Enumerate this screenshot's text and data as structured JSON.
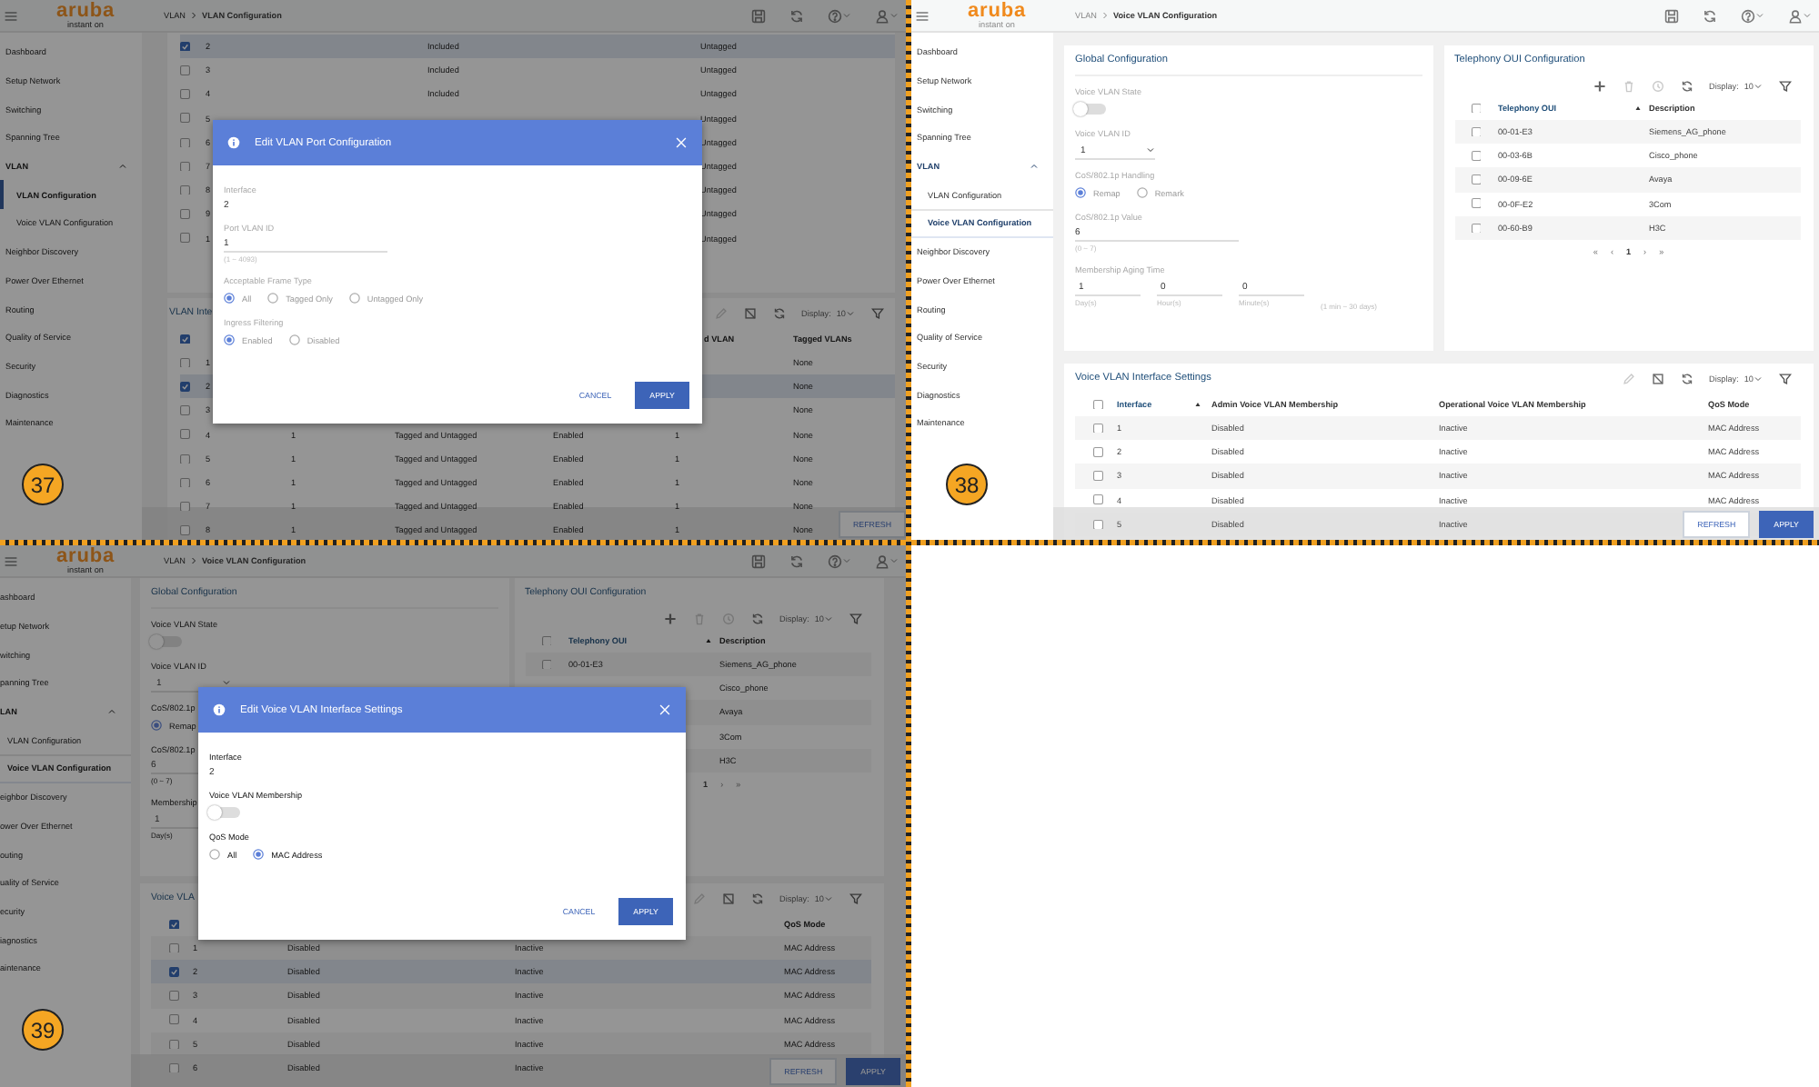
{
  "panels": [
    {
      "kind": "vlan_port",
      "badge": "37",
      "dimmed": true,
      "header": {
        "logo": "aruba",
        "logo_sub": "instant on",
        "breadcrumb": [
          "VLAN",
          "VLAN Configuration"
        ]
      },
      "sidebar": [
        {
          "label": "Dashboard",
          "selected": false
        },
        {
          "label": "Setup Network",
          "selected": false
        },
        {
          "label": "Switching",
          "selected": false
        },
        {
          "label": "Spanning Tree",
          "selected": false
        },
        {
          "label": "VLAN",
          "selected": false,
          "expanded": true,
          "children": [
            {
              "label": "VLAN Configuration",
              "selected": true
            },
            {
              "label": "Voice VLAN Configuration",
              "selected": false
            }
          ]
        },
        {
          "label": "Neighbor Discovery",
          "selected": false
        },
        {
          "label": "Power Over Ethernet",
          "selected": false
        },
        {
          "label": "Routing",
          "selected": false
        },
        {
          "label": "Quality of Service",
          "selected": false
        },
        {
          "label": "Security",
          "selected": false
        },
        {
          "label": "Diagnostics",
          "selected": false
        },
        {
          "label": "Maintenance",
          "selected": false
        }
      ],
      "membership_table": {
        "rows": [
          {
            "interface": "2",
            "checked": true,
            "membership": "Included",
            "tagging": "Untagged"
          },
          {
            "interface": "3",
            "checked": false,
            "membership": "Included",
            "tagging": "Untagged"
          },
          {
            "interface": "4",
            "checked": false,
            "membership": "Included",
            "tagging": "Untagged"
          },
          {
            "interface": "5",
            "checked": false,
            "tagging": "Untagged"
          },
          {
            "interface": "6",
            "checked": false,
            "tagging": "Untagged"
          },
          {
            "interface": "7",
            "checked": false,
            "tagging": "Untagged"
          },
          {
            "interface": "8",
            "checked": false,
            "tagging": "Untagged"
          },
          {
            "interface": "9",
            "checked": false,
            "tagging": "Untagged"
          },
          {
            "interface": "1",
            "checked": false,
            "tagging": "Untagged"
          }
        ]
      },
      "interface_table": {
        "title": "VLAN Inte",
        "toolbar": {
          "tools": [
            {
              "kind": "edit",
              "disabled": true
            },
            {
              "kind": "clear",
              "disabled": false
            },
            {
              "kind": "refresh",
              "disabled": false
            }
          ],
          "display_label": "Display:",
          "display_value": "10"
        },
        "header": {
          "checked": true,
          "untagged": "d VLAN",
          "tagged": "Tagged VLANs"
        },
        "rows": [
          {
            "interface": "1",
            "checked": false,
            "tagged": "None"
          },
          {
            "interface": "2",
            "checked": true,
            "tagged": "None"
          },
          {
            "interface": "3",
            "checked": false,
            "tagged": "None"
          },
          {
            "interface": "4",
            "checked": false,
            "pvid": "1",
            "frame": "Tagged and Untagged",
            "ingress": "Enabled",
            "untagged": "1",
            "tagged": "None"
          },
          {
            "interface": "5",
            "checked": false,
            "pvid": "1",
            "frame": "Tagged and Untagged",
            "ingress": "Enabled",
            "untagged": "1",
            "tagged": "None"
          },
          {
            "interface": "6",
            "checked": false,
            "pvid": "1",
            "frame": "Tagged and Untagged",
            "ingress": "Enabled",
            "untagged": "1",
            "tagged": "None"
          },
          {
            "interface": "7",
            "checked": false,
            "pvid": "1",
            "frame": "Tagged and Untagged",
            "ingress": "Enabled",
            "untagged": "1",
            "tagged": "None"
          },
          {
            "interface": "8",
            "checked": false,
            "pvid": "1",
            "frame": "Tagged and Untagged",
            "ingress": "Enabled",
            "untagged": "1",
            "tagged": "None"
          }
        ]
      },
      "footer": {
        "buttons": [
          {
            "label": "REFRESH",
            "kind": "outline"
          }
        ]
      },
      "modal": {
        "title": "Edit VLAN Port Configuration",
        "fields": [
          {
            "kind": "static",
            "label": "Interface",
            "value": "2"
          },
          {
            "kind": "input",
            "label": "Port VLAN ID",
            "value": "1",
            "hint": "(1 ~ 4093)"
          },
          {
            "kind": "radio",
            "label": "Acceptable Frame Type",
            "options": [
              {
                "label": "All",
                "selected": true
              },
              {
                "label": "Tagged Only",
                "selected": false
              },
              {
                "label": "Untagged Only",
                "selected": false
              }
            ]
          },
          {
            "kind": "radio",
            "label": "Ingress Filtering",
            "options": [
              {
                "label": "Enabled",
                "selected": true
              },
              {
                "label": "Disabled",
                "selected": false
              }
            ]
          }
        ],
        "buttons": [
          {
            "label": "CANCEL",
            "kind": "text"
          },
          {
            "label": "APPLY",
            "kind": "primary"
          }
        ]
      }
    },
    {
      "kind": "voice_vlan",
      "badge": "38",
      "dimmed": false,
      "header": {
        "logo": "aruba",
        "logo_sub": "instant on",
        "breadcrumb": [
          "VLAN",
          "Voice VLAN Configuration"
        ]
      },
      "sidebar": [
        {
          "label": "Dashboard",
          "selected": false
        },
        {
          "label": "Setup Network",
          "selected": false
        },
        {
          "label": "Switching",
          "selected": false
        },
        {
          "label": "Spanning Tree",
          "selected": false
        },
        {
          "label": "VLAN",
          "selected": false,
          "expanded": true,
          "children": [
            {
              "label": "VLAN Configuration",
              "selected": false
            },
            {
              "label": "Voice VLAN Configuration",
              "selected": true
            }
          ]
        },
        {
          "label": "Neighbor Discovery",
          "selected": false
        },
        {
          "label": "Power Over Ethernet",
          "selected": false
        },
        {
          "label": "Routing",
          "selected": false
        },
        {
          "label": "Quality of Service",
          "selected": false
        },
        {
          "label": "Security",
          "selected": false
        },
        {
          "label": "Diagnostics",
          "selected": false
        },
        {
          "label": "Maintenance",
          "selected": false
        }
      ],
      "global": {
        "title": "Global Configuration",
        "state_label": "Voice VLAN State",
        "state_on": false,
        "id_label": "Voice VLAN ID",
        "id_value": "1",
        "handling_label": "CoS/802.1p Handling",
        "handling_options": [
          {
            "label": "Remap",
            "selected": true
          },
          {
            "label": "Remark",
            "selected": false
          }
        ],
        "value_label": "CoS/802.1p Value",
        "value": "6",
        "value_hint": "(0 ~ 7)",
        "aging_label": "Membership Aging Time",
        "aging": [
          {
            "value": "1",
            "unit": "Day(s)"
          },
          {
            "value": "0",
            "unit": "Hour(s)"
          },
          {
            "value": "0",
            "unit": "Minute(s)"
          }
        ],
        "aging_hint": "(1 min ~ 30 days)"
      },
      "telephony": {
        "title": "Telephony OUI Configuration",
        "toolbar": {
          "tools": [
            {
              "kind": "add",
              "disabled": false
            },
            {
              "kind": "delete",
              "disabled": true
            },
            {
              "kind": "history",
              "disabled": true
            },
            {
              "kind": "refresh",
              "disabled": false
            }
          ],
          "display_label": "Display:",
          "display_value": "10"
        },
        "header": {
          "checked": false,
          "oui": "Telephony OUI",
          "sorted": true,
          "description": "Description"
        },
        "rows": [
          {
            "checked": false,
            "oui": "00-01-E3",
            "description": "Siemens_AG_phone"
          },
          {
            "checked": false,
            "oui": "00-03-6B",
            "description": "Cisco_phone"
          },
          {
            "checked": false,
            "oui": "00-09-6E",
            "description": "Avaya"
          },
          {
            "checked": false,
            "oui": "00-0F-E2",
            "description": "3Com"
          },
          {
            "checked": false,
            "oui": "00-60-B9",
            "description": "H3C"
          }
        ],
        "pagination": [
          {
            "label": "«",
            "selected": false
          },
          {
            "label": "‹",
            "selected": false
          },
          {
            "label": "1",
            "selected": true
          },
          {
            "label": "›",
            "selected": false
          },
          {
            "label": "»",
            "selected": false
          }
        ]
      },
      "interfaces": {
        "title": "Voice VLAN Interface Settings",
        "toolbar": {
          "tools": [
            {
              "kind": "edit",
              "disabled": true
            },
            {
              "kind": "clear",
              "disabled": false
            },
            {
              "kind": "refresh",
              "disabled": false
            }
          ],
          "display_label": "Display:",
          "display_value": "10"
        },
        "header": {
          "checked": false,
          "interface": "Interface",
          "sorted": true,
          "admin": "Admin Voice VLAN Membership",
          "operational": "Operational Voice VLAN Membership",
          "qos": "QoS Mode"
        },
        "rows": [
          {
            "checked": false,
            "interface": "1",
            "admin": "Disabled",
            "operational": "Inactive",
            "qos": "MAC Address"
          },
          {
            "checked": false,
            "interface": "2",
            "admin": "Disabled",
            "operational": "Inactive",
            "qos": "MAC Address"
          },
          {
            "checked": false,
            "interface": "3",
            "admin": "Disabled",
            "operational": "Inactive",
            "qos": "MAC Address"
          },
          {
            "checked": false,
            "interface": "4",
            "admin": "Disabled",
            "operational": "Inactive",
            "qos": "MAC Address"
          },
          {
            "checked": false,
            "interface": "5",
            "admin": "Disabled",
            "operational": "Inactive"
          }
        ]
      },
      "footer": {
        "buttons": [
          {
            "label": "REFRESH",
            "kind": "outline"
          },
          {
            "label": "APPLY",
            "kind": "primary"
          }
        ]
      }
    },
    {
      "kind": "voice_vlan",
      "badge": "39",
      "dimmed": true,
      "header": {
        "logo": "aruba",
        "logo_sub": "instant on",
        "breadcrumb": [
          "VLAN",
          "Voice VLAN Configuration"
        ]
      },
      "sidebar": [
        {
          "label": "ashboard",
          "selected": false
        },
        {
          "label": "etup Network",
          "selected": false
        },
        {
          "label": "witching",
          "selected": false
        },
        {
          "label": "panning Tree",
          "selected": false
        },
        {
          "label": "LAN",
          "selected": false,
          "expanded": true,
          "children": [
            {
              "label": "VLAN Configuration",
              "selected": false
            },
            {
              "label": "Voice VLAN Configuration",
              "selected": true
            }
          ]
        },
        {
          "label": "eighbor Discovery",
          "selected": false
        },
        {
          "label": "ower Over Ethernet",
          "selected": false
        },
        {
          "label": "outing",
          "selected": false
        },
        {
          "label": "uality of Service",
          "selected": false
        },
        {
          "label": "ecurity",
          "selected": false
        },
        {
          "label": "iagnostics",
          "selected": false
        },
        {
          "label": "aintenance",
          "selected": false
        }
      ],
      "global": {
        "title": "Global Configuration",
        "state_label": "Voice VLAN State",
        "state_on": false,
        "id_label": "Voice VLAN ID",
        "id_value": "1",
        "handling_label": "CoS/802.1p",
        "handling_options": [
          {
            "label": "Remap",
            "selected": true
          }
        ],
        "value_label": "CoS/802.1p",
        "value": "6",
        "value_hint": "(0 ~ 7)",
        "aging_label": "Membership",
        "aging": [
          {
            "value": "1",
            "unit": "Day(s)"
          }
        ]
      },
      "telephony": {
        "title": "Telephony OUI Configuration",
        "toolbar": {
          "tools": [
            {
              "kind": "add",
              "disabled": false
            },
            {
              "kind": "delete",
              "disabled": true
            },
            {
              "kind": "history",
              "disabled": true
            },
            {
              "kind": "refresh",
              "disabled": false
            }
          ],
          "display_label": "Display:",
          "display_value": "10"
        },
        "header": {
          "checked": false,
          "oui": "Telephony OUI",
          "sorted": true,
          "description": "Description"
        },
        "rows": [
          {
            "checked": false,
            "oui": "00-01-E3",
            "description": "Siemens_AG_phone"
          },
          {
            "description": "Cisco_phone"
          },
          {
            "description": "Avaya"
          },
          {
            "description": "3Com"
          },
          {
            "description": "H3C"
          }
        ],
        "pagination": [
          {
            "label": "1",
            "selected": true
          },
          {
            "label": "›",
            "selected": false
          },
          {
            "label": "»",
            "selected": false
          }
        ]
      },
      "interfaces": {
        "title": "Voice VLA",
        "toolbar": {
          "tools": [
            {
              "kind": "edit",
              "disabled": true
            },
            {
              "kind": "clear",
              "disabled": false
            },
            {
              "kind": "refresh",
              "disabled": false
            }
          ],
          "display_label": "Display:",
          "display_value": "10"
        },
        "header": {
          "checked": true,
          "qos": "QoS Mode"
        },
        "rows": [
          {
            "checked": false,
            "interface": "1",
            "admin": "Disabled",
            "operational": "Inactive",
            "qos": "MAC Address"
          },
          {
            "checked": true,
            "interface": "2",
            "admin": "Disabled",
            "operational": "Inactive",
            "qos": "MAC Address"
          },
          {
            "checked": false,
            "interface": "3",
            "admin": "Disabled",
            "operational": "Inactive",
            "qos": "MAC Address"
          },
          {
            "checked": false,
            "interface": "4",
            "admin": "Disabled",
            "operational": "Inactive",
            "qos": "MAC Address"
          },
          {
            "checked": false,
            "interface": "5",
            "admin": "Disabled",
            "operational": "Inactive",
            "qos": "MAC Address"
          },
          {
            "checked": false,
            "interface": "6",
            "admin": "Disabled",
            "operational": "Inactive"
          }
        ]
      },
      "footer": {
        "buttons": [
          {
            "label": "REFRESH",
            "kind": "outline"
          },
          {
            "label": "APPLY",
            "kind": "primary"
          }
        ]
      },
      "modal": {
        "title": "Edit Voice VLAN Interface Settings",
        "fields": [
          {
            "kind": "static",
            "label": "Interface",
            "value": "2"
          },
          {
            "kind": "toggle",
            "label": "Voice VLAN Membership",
            "on": false
          },
          {
            "kind": "radio",
            "label": "QoS Mode",
            "options": [
              {
                "label": "All",
                "selected": false
              },
              {
                "label": "MAC Address",
                "selected": true
              }
            ]
          }
        ],
        "buttons": [
          {
            "label": "CANCEL",
            "kind": "text"
          },
          {
            "label": "APPLY",
            "kind": "primary"
          }
        ]
      }
    }
  ]
}
